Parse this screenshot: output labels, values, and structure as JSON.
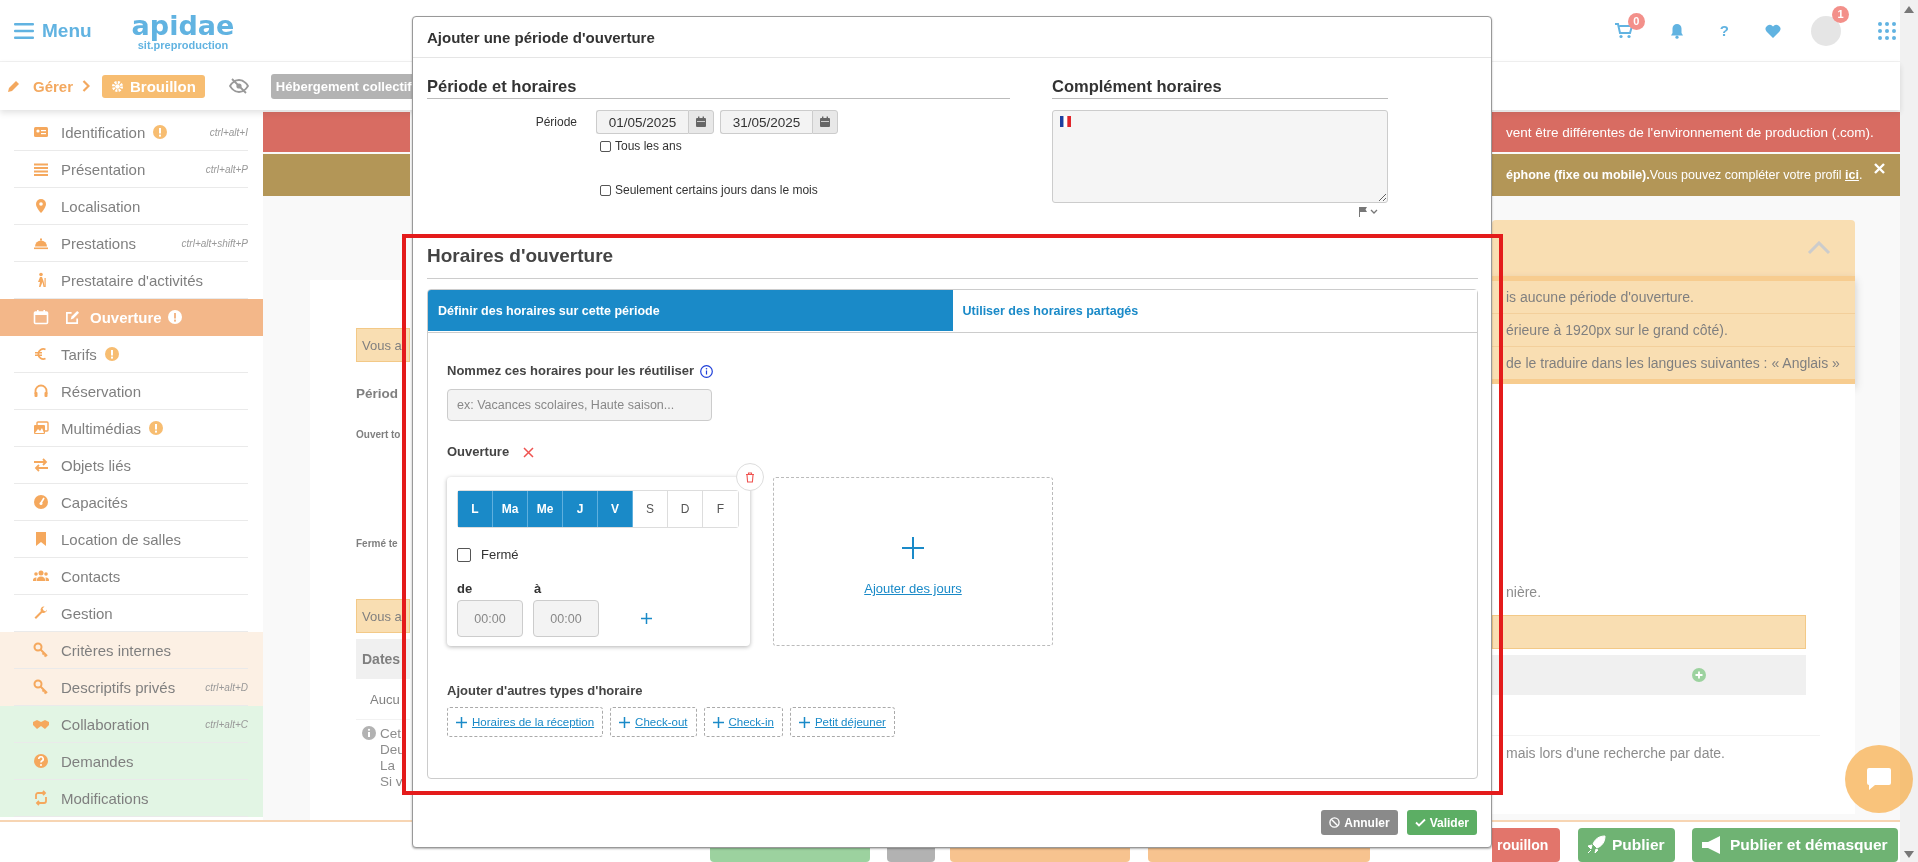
{
  "header": {
    "menu_label": "Menu",
    "logo_name": "apidae",
    "logo_subtitle": "sit.preproduction",
    "cart_count": "0",
    "help_label": "?",
    "account_badge": "1"
  },
  "toolbar": {
    "breadcrumb": "Gérer",
    "status": "Brouillon",
    "object_type": "Hébergement collectif"
  },
  "sidebar": {
    "items": [
      {
        "label": "Identification",
        "shortcut": "ctrl+alt+I",
        "warning": true,
        "selected": false,
        "kind": "main"
      },
      {
        "label": "Présentation",
        "shortcut": "ctrl+alt+P",
        "warning": false,
        "selected": false,
        "kind": "main"
      },
      {
        "label": "Localisation",
        "warning": false,
        "selected": false,
        "kind": "main"
      },
      {
        "label": "Prestations",
        "shortcut": "ctrl+alt+shift+P",
        "warning": false,
        "selected": false,
        "kind": "main"
      },
      {
        "label": "Prestataire d'activités",
        "warning": false,
        "selected": false,
        "kind": "main"
      },
      {
        "label": "Ouverture",
        "warning": true,
        "selected": true,
        "kind": "main"
      },
      {
        "label": "Tarifs",
        "warning": true,
        "selected": false,
        "kind": "main"
      },
      {
        "label": "Réservation",
        "warning": false,
        "selected": false,
        "kind": "main"
      },
      {
        "label": "Multimédias",
        "warning": true,
        "selected": false,
        "kind": "main"
      },
      {
        "label": "Objets liés",
        "warning": false,
        "selected": false,
        "kind": "main"
      },
      {
        "label": "Capacités",
        "warning": false,
        "selected": false,
        "kind": "main"
      },
      {
        "label": "Location de salles",
        "warning": false,
        "selected": false,
        "kind": "main"
      },
      {
        "label": "Contacts",
        "warning": false,
        "selected": false,
        "kind": "main"
      },
      {
        "label": "Gestion",
        "warning": false,
        "selected": false,
        "kind": "main"
      },
      {
        "label": "Critères internes",
        "warning": false,
        "selected": false,
        "kind": "private"
      },
      {
        "label": "Descriptifs privés",
        "shortcut": "ctrl+alt+D",
        "warning": false,
        "selected": false,
        "kind": "private"
      },
      {
        "label": "Collaboration",
        "shortcut": "ctrl+alt+C",
        "warning": false,
        "selected": false,
        "kind": "collab"
      },
      {
        "label": "Demandes",
        "warning": false,
        "selected": false,
        "kind": "collab"
      },
      {
        "label": "Modifications",
        "warning": false,
        "selected": false,
        "kind": "collab"
      }
    ]
  },
  "background": {
    "env_notice": "vent être différentes de l'environnement de production (.com).",
    "profile_notice": {
      "text": "**éphone (fixe ou mobile).**Vous pouvez compléter votre profil ",
      "link": "ici",
      "end": "."
    },
    "alerts": [
      "is aucune période d'ouverture.",
      "érieure à 1920px sur le grand côté).",
      "de le traduire dans les langues suivantes : « Anglais »"
    ],
    "left_fragments": {
      "notice_1": "Vous a",
      "heading": "Périod",
      "open_label": "Ouvert to",
      "closed_label": "Fermé te",
      "notice_2": "Vous a",
      "table_header": "Dates",
      "table_row": "Aucu",
      "info_lines": [
        "Cet",
        "Deu",
        "La",
        "Si v"
      ]
    },
    "right_fragments": {
      "text_1": "nière.",
      "text_2": "mais lors d'une recherche par date."
    }
  },
  "modal": {
    "title": "Ajouter une période d'ouverture",
    "period": {
      "heading": "Période et horaires",
      "label": "Période",
      "start": "01/05/2025",
      "end": "31/05/2025",
      "options": [
        {
          "label": "Tous les ans",
          "checked": false
        },
        {
          "label": "Seulement certains jours dans le mois",
          "checked": false
        }
      ]
    },
    "complement": {
      "heading": "Complément horaires"
    },
    "hours": {
      "heading": "Horaires d'ouverture",
      "tabs": [
        {
          "label": "Définir des horaires sur cette période",
          "selected": true
        },
        {
          "label": "Utiliser des horaires partagés",
          "selected": false
        }
      ],
      "name_label": "Nommez ces horaires pour les réutiliser",
      "name_placeholder": "ex: Vacances scolaires, Haute saison...",
      "opening_label": "Ouverture",
      "days": [
        {
          "label": "L",
          "selected": true
        },
        {
          "label": "Ma",
          "selected": true
        },
        {
          "label": "Me",
          "selected": true
        },
        {
          "label": "J",
          "selected": true
        },
        {
          "label": "V",
          "selected": true
        },
        {
          "label": "S",
          "selected": false
        },
        {
          "label": "D",
          "selected": false
        },
        {
          "label": "F",
          "selected": false
        }
      ],
      "closed": {
        "label": "Fermé",
        "checked": false
      },
      "from_label": "de",
      "to_label": "à",
      "from_placeholder": "00:00",
      "to_placeholder": "00:00",
      "add_days": "Ajouter des jours",
      "other_types_label": "Ajouter d'autres types d'horaire",
      "other_types": [
        "Horaires de la réception",
        "Check-out",
        "Check-in",
        "Petit déjeuner"
      ]
    },
    "buttons": [
      {
        "label": "Annuler",
        "kind": "cancel"
      },
      {
        "label": "Valider",
        "kind": "confirm"
      }
    ]
  },
  "bottom_bar": {
    "buttons": [
      {
        "label": "rouillon",
        "kind": "draft"
      },
      {
        "label": "Publier",
        "kind": "publish"
      },
      {
        "label": "Publier et démasquer",
        "kind": "publish_show"
      }
    ]
  }
}
